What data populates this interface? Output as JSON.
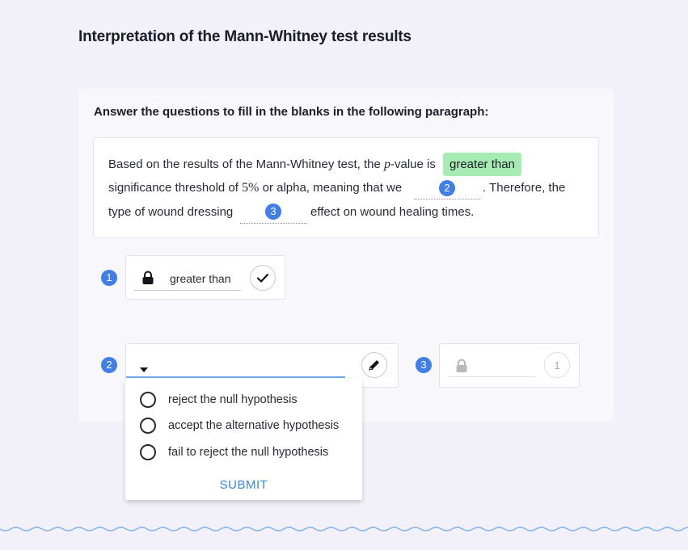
{
  "page": {
    "title": "Interpretation of the Mann-Whitney test results",
    "instructions": "Answer the questions to fill in the blanks in the following paragraph:"
  },
  "paragraph": {
    "line1_text": "Based on the results of the Mann-Whitney test, the ",
    "p_symbol": "p",
    "line1_after_p": "-value is",
    "filled_answer_1": "greater than",
    "line2_start": "significance threshold of ",
    "threshold": "5%",
    "line2_after": " or alpha, meaning that we",
    "blank2_number": "2",
    "line2_end": ". Therefore, the",
    "line3_start": "type of wound dressing",
    "blank3_number": "3",
    "line3_end": "effect on wound healing times."
  },
  "question1": {
    "number": "1",
    "answer": "greater than",
    "status": "correct"
  },
  "question2": {
    "number": "2",
    "options": [
      "reject the null hypothesis",
      "accept the alternative hypothesis",
      "fail to reject the null hypothesis"
    ],
    "submit_label": "SUBMIT"
  },
  "question3": {
    "number": "3",
    "attempts": "1"
  },
  "colors": {
    "background": "#f2f1f9",
    "accent_blue": "#3f7fe6",
    "answer_highlight": "#a6ebb2",
    "submit_text": "#3c86d8"
  },
  "icons": [
    "lock-icon",
    "check-icon",
    "caret-down-icon",
    "pencil-icon",
    "radio-icon"
  ]
}
